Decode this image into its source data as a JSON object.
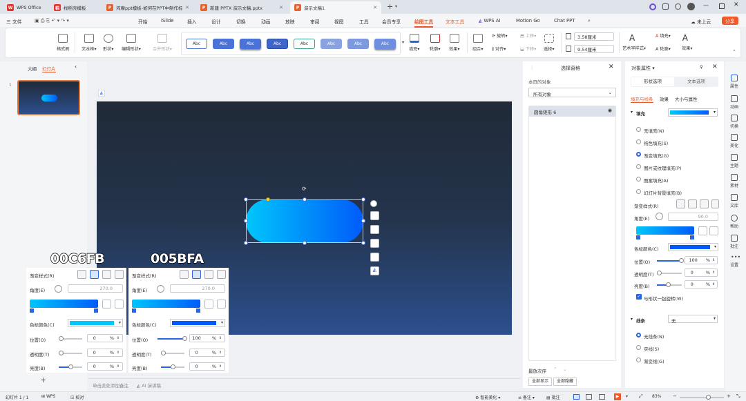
{
  "tabs": [
    {
      "label": "WPS Office",
      "icon": "wps-logo-icon",
      "color": "#e5322d"
    },
    {
      "label": "找稻壳模板",
      "icon": "docer-icon",
      "color": "#e5322d"
    },
    {
      "label": "鸿摩ppt模板-如何在PPT中制作标",
      "icon": "ppt-file-icon",
      "color": "#e8602c"
    },
    {
      "label": "新建 PPTX 演示文稿.pptx",
      "icon": "ppt-file-icon",
      "color": "#e8602c"
    },
    {
      "label": "演示文稿1",
      "icon": "ppt-file-icon",
      "color": "#e8602c"
    }
  ],
  "ribbon": {
    "file": "三 文件",
    "items": [
      "开始",
      "iSlide",
      "插入",
      "设计",
      "切换",
      "动画",
      "放映",
      "审阅",
      "视图",
      "工具",
      "会员专享",
      "绘图工具",
      "文本工具",
      "WPS AI",
      "Motion Go",
      "Chat PPT"
    ],
    "active": "绘图工具",
    "cloud": "未上云",
    "share": "分享"
  },
  "toolbar": {
    "format_painter": "格式刷",
    "textbox": "文本框▾",
    "shape": "形状▾",
    "edit_shape": "编辑形状▾",
    "merge_shape": "合并形状▾",
    "style_samples": [
      "Abc",
      "Abc",
      "Abc",
      "Abc",
      "Abc",
      "Abc",
      "Abc",
      "Abc"
    ],
    "fill": "填充▾",
    "outline": "轮廓▾",
    "effect": "效果▾",
    "group": "组合▾",
    "rotate": "旋转▾",
    "align": "对齐▾",
    "bring_up": "上移▾",
    "send_down": "下移▾",
    "select": "选择▾",
    "height": "3.58厘米",
    "width": "9.54厘米",
    "art_text": "艺术字样式▾",
    "text_fill": "填充▾",
    "text_outline": "轮廓▾",
    "text_effect": "效果▾"
  },
  "left_panel": {
    "outline_tab": "大纲",
    "slides_tab": "幻灯片",
    "slide_num": "1"
  },
  "notes_placeholder": "单击此处添加备注",
  "ai_notes": "AI 演讲稿",
  "selection_pane": {
    "title": "选择窗格",
    "objects_label": "本页的对象",
    "filter": "所有对象",
    "item": "圆角矩形 6",
    "order": "最放次序",
    "show_all": "全部显示",
    "hide_all": "全部隐藏"
  },
  "props": {
    "title": "对象属性 ▾",
    "tab_shape": "形状选项",
    "tab_text": "文本选项",
    "sub_fill_line": "填充与线条",
    "sub_effect": "效果",
    "sub_size": "大小与属性",
    "fill_section": "填充",
    "fill_options": [
      "无填充(N)",
      "纯色填充(S)",
      "渐变填充(G)",
      "图片或纹理填充(P)",
      "图案填充(A)",
      "幻灯片背景填充(B)"
    ],
    "selected_fill": 2,
    "gradient_style": "渐变样式(R)",
    "angle_label": "角度(E)",
    "angle_value": "90.0",
    "stop_color": "色标颜色(C)",
    "position_label": "位置(O)",
    "position_value": "100",
    "position_fraction": 1.0,
    "transparency_label": "透明度(T)",
    "transparency_value": "0",
    "brightness_label": "亮度(B)",
    "brightness_value": "0",
    "rotate_with_shape": "与形状一起旋转(W)",
    "line_section": "线条",
    "line_value": "无",
    "line_options": [
      "无线条(N)",
      "实线(S)",
      "渐变线(G)"
    ],
    "selected_line": 0,
    "unit_percent": "%"
  },
  "sidebar": [
    "属性",
    "动画",
    "切换",
    "美化",
    "主题",
    "素材",
    "文库",
    "帮助",
    "批注",
    "设置"
  ],
  "panels": [
    {
      "label": "00C6FB",
      "gradient_style": "渐变样式(R)",
      "angle_label": "角度(E)",
      "angle_value": "270.0",
      "stop_color_label": "色标颜色(C)",
      "color": "#00C6FB",
      "position_label": "位置(O)",
      "position_value": "0",
      "position_fraction": 0.0,
      "transparency_label": "透明度(T)",
      "transparency_value": "0",
      "brightness_label": "亮度(B)",
      "brightness_value": "0",
      "unit": "%"
    },
    {
      "label": "005BFA",
      "gradient_style": "渐变样式(R)",
      "angle_label": "角度(E)",
      "angle_value": "270.0",
      "stop_color_label": "色标颜色(C)",
      "color": "#005BFA",
      "position_label": "位置(O)",
      "position_value": "100",
      "position_fraction": 1.0,
      "transparency_label": "透明度(T)",
      "transparency_value": "0",
      "brightness_label": "亮度(B)",
      "brightness_value": "0",
      "unit": "%"
    }
  ],
  "status": {
    "slide": "幻灯片 1 / 1",
    "wps": "WPS",
    "proofread": "校对",
    "beautify": "智能美化",
    "notes": "备注",
    "comments": "批注",
    "zoom": "83%"
  },
  "colors": {
    "accent": "#2866e0",
    "gradient_start": "#00C6FB",
    "gradient_end": "#005BFA",
    "slide_top": "#202a38",
    "slide_bottom": "#2c4f8e",
    "share": "#f05a28"
  }
}
